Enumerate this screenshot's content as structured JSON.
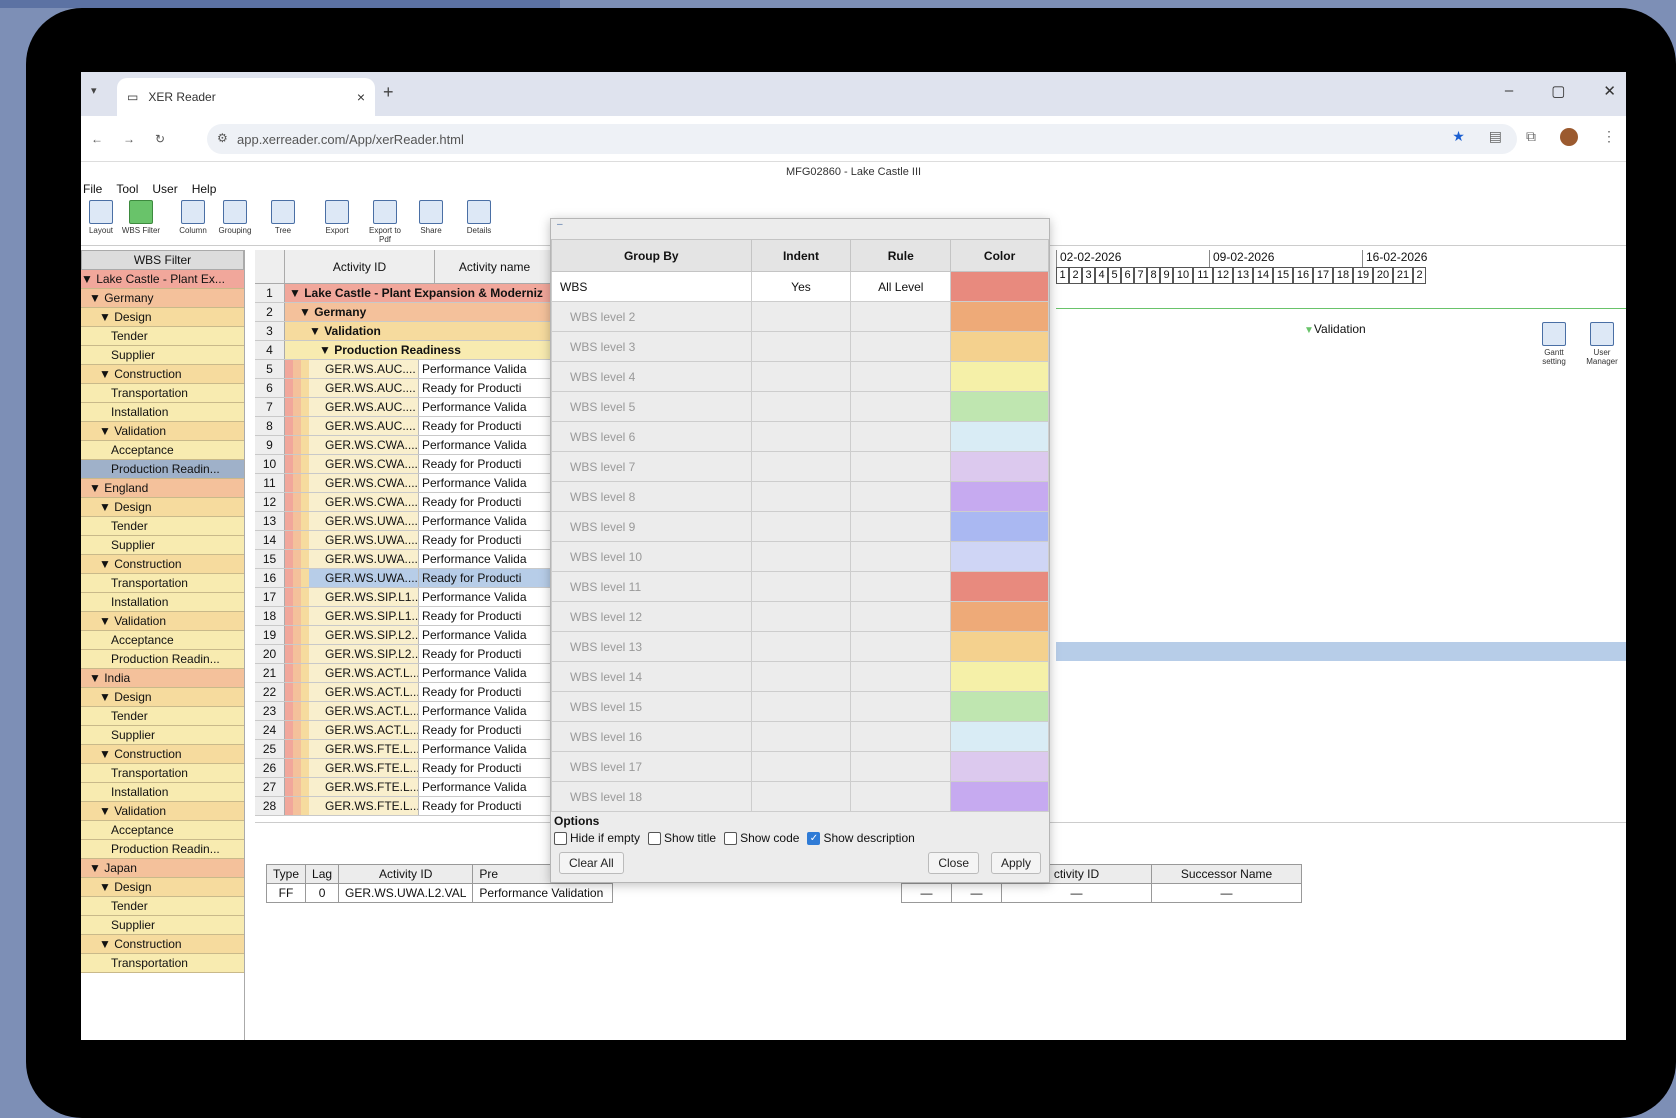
{
  "browser": {
    "tab_title": "XER Reader",
    "url": "app.xerreader.com/App/xerReader.html",
    "tab_close": "×",
    "new_tab": "+",
    "window_controls": [
      "–",
      "▢",
      "✕"
    ]
  },
  "app": {
    "title": "MFG02860 - Lake Castle III",
    "menu": [
      "File",
      "Tool",
      "User",
      "Help"
    ],
    "toolbar": [
      "Layout",
      "WBS Filter",
      "Column",
      "Grouping",
      "Tree",
      "Export",
      "Export to Pdf",
      "Share",
      "Details"
    ],
    "toolbar_right": [
      "Gantt setting",
      "User Manager"
    ]
  },
  "wbs_filter": {
    "header": "WBS Filter",
    "items": [
      {
        "label": "▼ Lake Castle - Plant Ex...",
        "level": 0
      },
      {
        "label": "▼ Germany",
        "level": 1
      },
      {
        "label": "▼ Design",
        "level": 2
      },
      {
        "label": "Tender",
        "level": 3
      },
      {
        "label": "Supplier",
        "level": 3
      },
      {
        "label": "▼ Construction",
        "level": 2
      },
      {
        "label": "Transportation",
        "level": 3
      },
      {
        "label": "Installation",
        "level": 3
      },
      {
        "label": "▼ Validation",
        "level": 2
      },
      {
        "label": "Acceptance",
        "level": 3
      },
      {
        "label": "Production Readin...",
        "level": 3,
        "selected": true
      },
      {
        "label": "▼ England",
        "level": 1
      },
      {
        "label": "▼ Design",
        "level": 2
      },
      {
        "label": "Tender",
        "level": 3
      },
      {
        "label": "Supplier",
        "level": 3
      },
      {
        "label": "▼ Construction",
        "level": 2
      },
      {
        "label": "Transportation",
        "level": 3
      },
      {
        "label": "Installation",
        "level": 3
      },
      {
        "label": "▼ Validation",
        "level": 2
      },
      {
        "label": "Acceptance",
        "level": 3
      },
      {
        "label": "Production Readin...",
        "level": 3
      },
      {
        "label": "▼ India",
        "level": 1
      },
      {
        "label": "▼ Design",
        "level": 2
      },
      {
        "label": "Tender",
        "level": 3
      },
      {
        "label": "Supplier",
        "level": 3
      },
      {
        "label": "▼ Construction",
        "level": 2
      },
      {
        "label": "Transportation",
        "level": 3
      },
      {
        "label": "Installation",
        "level": 3
      },
      {
        "label": "▼ Validation",
        "level": 2
      },
      {
        "label": "Acceptance",
        "level": 3
      },
      {
        "label": "Production Readin...",
        "level": 3
      },
      {
        "label": "▼ Japan",
        "level": 1
      },
      {
        "label": "▼ Design",
        "level": 2
      },
      {
        "label": "Tender",
        "level": 3
      },
      {
        "label": "Supplier",
        "level": 3
      },
      {
        "label": "▼ Construction",
        "level": 2
      },
      {
        "label": "Transportation",
        "level": 3
      }
    ]
  },
  "grid": {
    "col_activity_id": "Activity ID",
    "col_activity_name": "Activity name",
    "header_rows": [
      {
        "n": "1",
        "text": "▼ Lake Castle - Plant Expansion & Moderniz"
      },
      {
        "n": "2",
        "text": "▼ Germany"
      },
      {
        "n": "3",
        "text": "▼ Validation"
      },
      {
        "n": "4",
        "text": "▼ Production Readiness"
      }
    ],
    "rows": [
      {
        "n": "5",
        "id": "GER.WS.AUC....",
        "name": "Performance Valida"
      },
      {
        "n": "6",
        "id": "GER.WS.AUC....",
        "name": "Ready for Producti"
      },
      {
        "n": "7",
        "id": "GER.WS.AUC....",
        "name": "Performance Valida"
      },
      {
        "n": "8",
        "id": "GER.WS.AUC....",
        "name": "Ready for Producti"
      },
      {
        "n": "9",
        "id": "GER.WS.CWA....",
        "name": "Performance Valida"
      },
      {
        "n": "10",
        "id": "GER.WS.CWA....",
        "name": "Ready for Producti"
      },
      {
        "n": "11",
        "id": "GER.WS.CWA....",
        "name": "Performance Valida"
      },
      {
        "n": "12",
        "id": "GER.WS.CWA....",
        "name": "Ready for Producti"
      },
      {
        "n": "13",
        "id": "GER.WS.UWA....",
        "name": "Performance Valida"
      },
      {
        "n": "14",
        "id": "GER.WS.UWA....",
        "name": "Ready for Producti"
      },
      {
        "n": "15",
        "id": "GER.WS.UWA....",
        "name": "Performance Valida"
      },
      {
        "n": "16",
        "id": "GER.WS.UWA....",
        "name": "Ready for Producti",
        "selected": true
      },
      {
        "n": "17",
        "id": "GER.WS.SIP.L1...",
        "name": "Performance Valida"
      },
      {
        "n": "18",
        "id": "GER.WS.SIP.L1...",
        "name": "Ready for Producti"
      },
      {
        "n": "19",
        "id": "GER.WS.SIP.L2...",
        "name": "Performance Valida"
      },
      {
        "n": "20",
        "id": "GER.WS.SIP.L2...",
        "name": "Ready for Producti"
      },
      {
        "n": "21",
        "id": "GER.WS.ACT.L...",
        "name": "Performance Valida"
      },
      {
        "n": "22",
        "id": "GER.WS.ACT.L...",
        "name": "Ready for Producti"
      },
      {
        "n": "23",
        "id": "GER.WS.ACT.L...",
        "name": "Performance Valida"
      },
      {
        "n": "24",
        "id": "GER.WS.ACT.L...",
        "name": "Ready for Producti"
      },
      {
        "n": "25",
        "id": "GER.WS.FTE.L...",
        "name": "Performance Valida"
      },
      {
        "n": "26",
        "id": "GER.WS.FTE.L...",
        "name": "Ready for Producti"
      },
      {
        "n": "27",
        "id": "GER.WS.FTE.L...",
        "name": "Performance Valida"
      },
      {
        "n": "28",
        "id": "GER.WS.FTE.L...",
        "name": "Ready for Producti"
      }
    ]
  },
  "gantt": {
    "weeks": [
      "02-02-2026",
      "09-02-2026",
      "16-02-2026"
    ],
    "days": [
      "1",
      "2",
      "3",
      "4",
      "5",
      "6",
      "7",
      "8",
      "9",
      "10",
      "11",
      "12",
      "13",
      "14",
      "15",
      "16",
      "17",
      "18",
      "19",
      "20",
      "21",
      "2"
    ],
    "label": "Validation",
    "accent": "#69c36a"
  },
  "predecessors": {
    "headers": [
      "Type",
      "Lag",
      "Activity ID",
      "Pre"
    ],
    "row": [
      "FF",
      "0",
      "GER.WS.UWA.L2.VAL",
      "Performance Validation"
    ]
  },
  "successors": {
    "headers": [
      "ctivity ID",
      "Successor Name"
    ],
    "row": [
      "—",
      "—",
      "—",
      "—"
    ]
  },
  "dialog": {
    "headers": [
      "Group By",
      "Indent",
      "Rule",
      "Color"
    ],
    "rows": [
      {
        "group": "WBS",
        "indent": "Yes",
        "rule": "All Level",
        "color": "#e88a7e"
      },
      {
        "group": "WBS level 2",
        "indent": "",
        "rule": "",
        "color": "#eeaa78"
      },
      {
        "group": "WBS level 3",
        "indent": "",
        "rule": "",
        "color": "#f4d18e"
      },
      {
        "group": "WBS level 4",
        "indent": "",
        "rule": "",
        "color": "#f5f0a8"
      },
      {
        "group": "WBS level 5",
        "indent": "",
        "rule": "",
        "color": "#bfe6b0"
      },
      {
        "group": "WBS level 6",
        "indent": "",
        "rule": "",
        "color": "#d9ecf5"
      },
      {
        "group": "WBS level 7",
        "indent": "",
        "rule": "",
        "color": "#dcc9ee"
      },
      {
        "group": "WBS level 8",
        "indent": "",
        "rule": "",
        "color": "#c6aaf0"
      },
      {
        "group": "WBS level 9",
        "indent": "",
        "rule": "",
        "color": "#aab8f2"
      },
      {
        "group": "WBS level 10",
        "indent": "",
        "rule": "",
        "color": "#cfd5f5"
      },
      {
        "group": "WBS level 11",
        "indent": "",
        "rule": "",
        "color": "#e88a7e"
      },
      {
        "group": "WBS level 12",
        "indent": "",
        "rule": "",
        "color": "#eeaa78"
      },
      {
        "group": "WBS level 13",
        "indent": "",
        "rule": "",
        "color": "#f4d18e"
      },
      {
        "group": "WBS level 14",
        "indent": "",
        "rule": "",
        "color": "#f5f0a8"
      },
      {
        "group": "WBS level 15",
        "indent": "",
        "rule": "",
        "color": "#bfe6b0"
      },
      {
        "group": "WBS level 16",
        "indent": "",
        "rule": "",
        "color": "#d9ecf5"
      },
      {
        "group": "WBS level 17",
        "indent": "",
        "rule": "",
        "color": "#dcc9ee"
      },
      {
        "group": "WBS level 18",
        "indent": "",
        "rule": "",
        "color": "#c6aaf0"
      }
    ],
    "options_label": "Options",
    "options": [
      {
        "label": "Hide if empty",
        "checked": false
      },
      {
        "label": "Show title",
        "checked": false
      },
      {
        "label": "Show code",
        "checked": false
      },
      {
        "label": "Show description",
        "checked": true
      }
    ],
    "clear_all": "Clear All",
    "close": "Close",
    "apply": "Apply"
  }
}
